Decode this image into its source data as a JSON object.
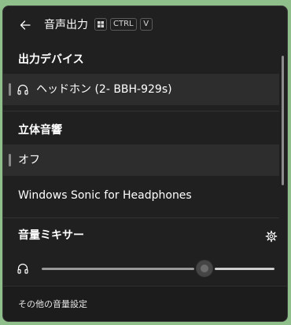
{
  "header": {
    "title": "音声出力",
    "shortcut_keys": [
      "CTRL",
      "V"
    ]
  },
  "output_devices": {
    "title": "出力デバイス",
    "items": [
      {
        "label": "ヘッドホン (2- BBH-929s)",
        "selected": true,
        "icon": "headphones-icon"
      }
    ]
  },
  "spatial_sound": {
    "title": "立体音響",
    "items": [
      {
        "label": "オフ",
        "selected": true
      },
      {
        "label": "Windows Sonic for Headphones",
        "selected": false
      }
    ]
  },
  "volume_mixer": {
    "title": "音量ミキサー",
    "settings_icon": "gear-icon",
    "device_icon": "headphones-icon",
    "level": 0.7
  },
  "footer": {
    "more_settings": "その他の音量設定"
  },
  "colors": {
    "panel": "#202020",
    "selected_row": "#2d2d2d",
    "desktop": "#8fbf8a"
  }
}
